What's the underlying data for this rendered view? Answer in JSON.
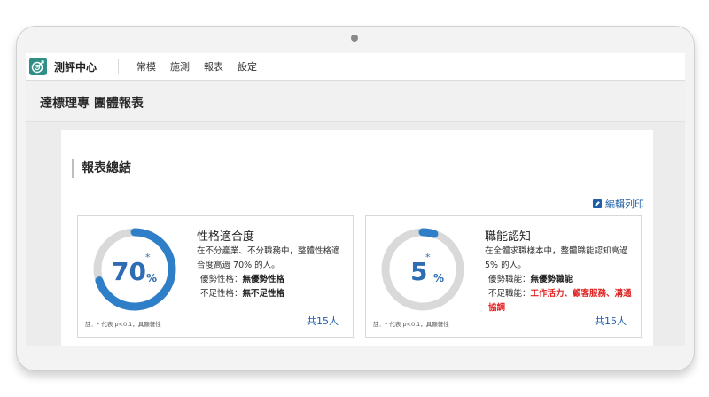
{
  "app": {
    "brand": "測評中心",
    "nav": [
      "常模",
      "施測",
      "報表",
      "設定"
    ]
  },
  "page": {
    "title": "達標理專 團體報表"
  },
  "summary": {
    "heading": "報表總結",
    "edit_print": "編輯列印"
  },
  "cards": [
    {
      "title": "性格適合度",
      "value": "70",
      "star": "*",
      "percent_sign": "%",
      "fill_percent": 70,
      "description": "在不分產業、不分職務中，整體性格適合度高過 70% 的人。",
      "strength_label": "優勢性格：",
      "strength_value": "無優勢性格",
      "weakness_label": "不足性格：",
      "weakness_value": "無不足性格",
      "note": "註：* 代表 p<0.1，具顯著性",
      "total": "共15人"
    },
    {
      "title": "職能認知",
      "value": "5",
      "star": "*",
      "percent_sign": "%",
      "fill_percent": 5,
      "description": "在全體求職樣本中，整體職能認知高過 5% 的人。",
      "strength_label": "優勢職能：",
      "strength_value": "無優勢職能",
      "weakness_label": "不足職能：",
      "weakness_value": "工作活力、顧客服務、溝通協調",
      "note": "註：* 代表 p<0.1，具顯著性",
      "total": "共15人"
    }
  ],
  "colors": {
    "ring_fill": "#2f7fc8",
    "ring_track": "#d9d9d9",
    "accent": "#1f5fa8",
    "warning": "#e02222"
  }
}
